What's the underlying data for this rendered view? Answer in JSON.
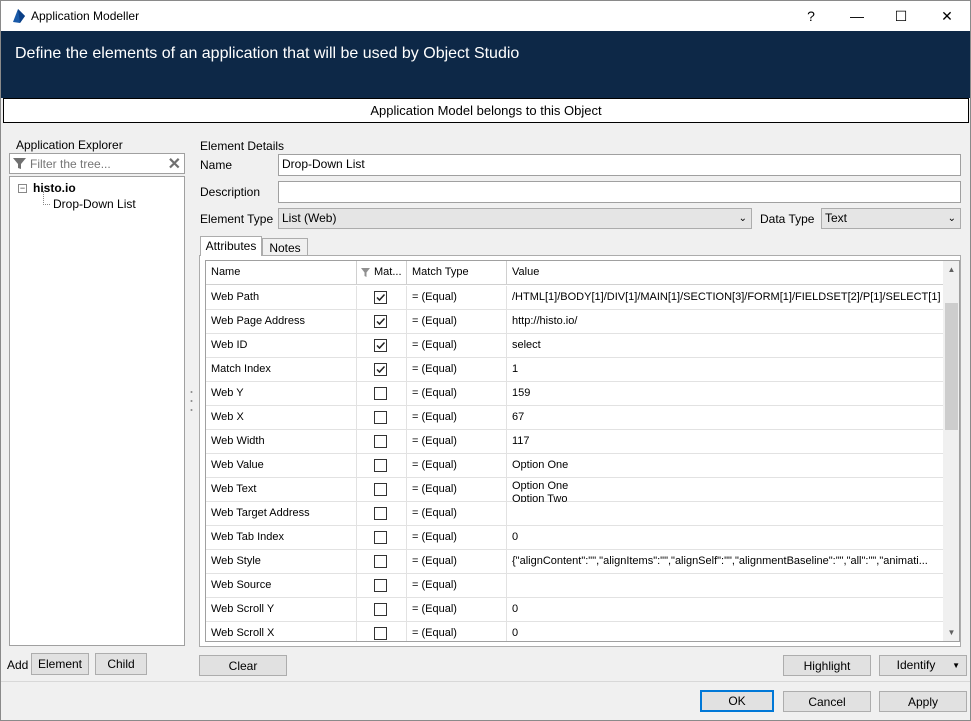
{
  "window": {
    "title": "Application Modeller",
    "help": "?",
    "minimize": "—",
    "maximize": "☐",
    "close": "✕"
  },
  "banner": {
    "text": "Define the elements of an application that will be used by Object Studio",
    "color": "#0d2847"
  },
  "model_bar": "Application Model belongs to this Object",
  "explorer": {
    "label": "Application Explorer",
    "filter_placeholder": "Filter the tree...",
    "tree": {
      "root": "histo.io",
      "toggle": "−",
      "child": "Drop-Down List"
    },
    "add_label": "Add",
    "element_button": "Element",
    "child_button": "Child"
  },
  "details": {
    "section_label": "Element Details",
    "name_label": "Name",
    "name_value": "Drop-Down List",
    "description_label": "Description",
    "description_value": "",
    "element_type_label": "Element Type",
    "element_type_value": "List (Web)",
    "data_type_label": "Data Type",
    "data_type_value": "Text"
  },
  "tabs": [
    {
      "label": "Attributes",
      "active": true
    },
    {
      "label": "Notes",
      "active": false
    }
  ],
  "grid": {
    "columns": [
      "Name",
      "Mat...",
      "Match Type",
      "Value"
    ],
    "rows": [
      {
        "name": "Web Path",
        "match": true,
        "match_type": "=  (Equal)",
        "value": "/HTML[1]/BODY[1]/DIV[1]/MAIN[1]/SECTION[3]/FORM[1]/FIELDSET[2]/P[1]/SELECT[1]"
      },
      {
        "name": "Web Page Address",
        "match": true,
        "match_type": "=  (Equal)",
        "value": "http://histo.io/"
      },
      {
        "name": "Web ID",
        "match": true,
        "match_type": "=  (Equal)",
        "value": "select"
      },
      {
        "name": "Match Index",
        "match": true,
        "match_type": "=  (Equal)",
        "value": "1"
      },
      {
        "name": "Web Y",
        "match": false,
        "match_type": "=  (Equal)",
        "value": "159"
      },
      {
        "name": "Web X",
        "match": false,
        "match_type": "=  (Equal)",
        "value": "67"
      },
      {
        "name": "Web Width",
        "match": false,
        "match_type": "=  (Equal)",
        "value": "117"
      },
      {
        "name": "Web Value",
        "match": false,
        "match_type": "=  (Equal)",
        "value": "Option One"
      },
      {
        "name": "Web Text",
        "match": false,
        "match_type": "=  (Equal)",
        "value": "Option One",
        "value2": "Option Two"
      },
      {
        "name": "Web Target Address",
        "match": false,
        "match_type": "=  (Equal)",
        "value": ""
      },
      {
        "name": "Web Tab Index",
        "match": false,
        "match_type": "=  (Equal)",
        "value": "0"
      },
      {
        "name": "Web Style",
        "match": false,
        "match_type": "=  (Equal)",
        "value": "{\"alignContent\":\"\",\"alignItems\":\"\",\"alignSelf\":\"\",\"alignmentBaseline\":\"\",\"all\":\"\",\"animati..."
      },
      {
        "name": "Web Source",
        "match": false,
        "match_type": "=  (Equal)",
        "value": ""
      },
      {
        "name": "Web Scroll Y",
        "match": false,
        "match_type": "=  (Equal)",
        "value": "0"
      },
      {
        "name": "Web Scroll X",
        "match": false,
        "match_type": "=  (Equal)",
        "value": "0"
      }
    ]
  },
  "buttons": {
    "clear": "Clear",
    "highlight": "Highlight",
    "identify": "Identify",
    "ok": "OK",
    "cancel": "Cancel",
    "apply": "Apply"
  }
}
